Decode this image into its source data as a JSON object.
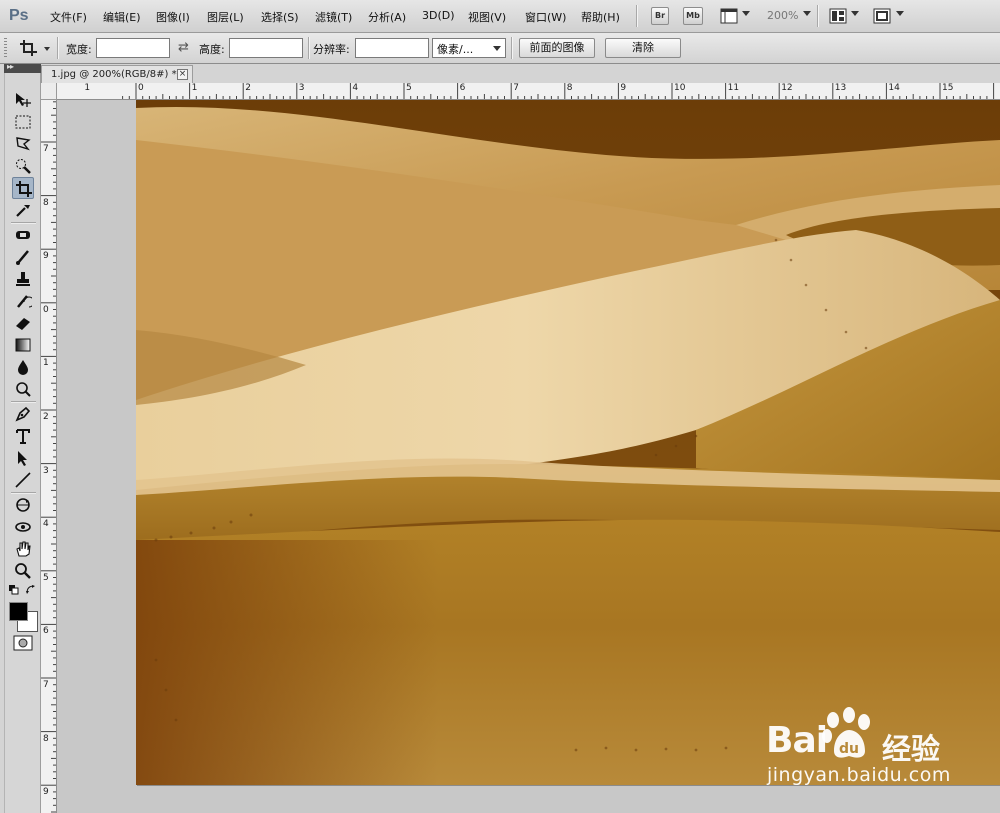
{
  "app": {
    "logo_text": "Ps",
    "menus": [
      "文件(F)",
      "编辑(E)",
      "图像(I)",
      "图层(L)",
      "选择(S)",
      "滤镜(T)",
      "分析(A)",
      "3D(D)",
      "视图(V)",
      "窗口(W)",
      "帮助(H)"
    ],
    "bridge_label": "Br",
    "minibridge_label": "Mb",
    "zoom": "200%"
  },
  "options": {
    "width_label": "宽度:",
    "width_value": "",
    "swap_symbol": "⇄",
    "height_label": "高度:",
    "height_value": "",
    "resolution_label": "分辨率:",
    "resolution_value": "",
    "unit_select": "像素/...",
    "front_image_button": "前面的图像",
    "clear_button": "清除"
  },
  "document": {
    "tab_title": "1.jpg @ 200%(RGB/8#) *",
    "close_symbol": "×"
  },
  "ruler": {
    "h_labels": [
      "1",
      "0",
      "1",
      "2",
      "3",
      "4",
      "5",
      "6",
      "7",
      "8",
      "9",
      "10",
      "11",
      "12",
      "13",
      "14",
      "15"
    ],
    "v_labels": [
      "7",
      "8",
      "9",
      "0",
      "1",
      "2",
      "3",
      "4",
      "5",
      "6",
      "7",
      "8",
      "9"
    ]
  },
  "tools": [
    {
      "name": "move-tool-icon"
    },
    {
      "name": "marquee-tool-icon"
    },
    {
      "name": "lasso-tool-icon"
    },
    {
      "name": "quick-select-tool-icon"
    },
    {
      "name": "crop-tool-icon",
      "active": true
    },
    {
      "name": "eyedropper-tool-icon"
    },
    {
      "name": "spot-healing-tool-icon"
    },
    {
      "name": "brush-tool-icon"
    },
    {
      "name": "clone-stamp-tool-icon"
    },
    {
      "name": "history-brush-tool-icon"
    },
    {
      "name": "eraser-tool-icon"
    },
    {
      "name": "gradient-tool-icon"
    },
    {
      "name": "blur-tool-icon"
    },
    {
      "name": "dodge-tool-icon"
    },
    {
      "name": "pen-tool-icon"
    },
    {
      "name": "type-tool-icon"
    },
    {
      "name": "path-select-tool-icon"
    },
    {
      "name": "line-tool-icon"
    },
    {
      "name": "3d-rotate-tool-icon"
    },
    {
      "name": "3d-orbit-tool-icon"
    },
    {
      "name": "hand-tool-icon"
    },
    {
      "name": "zoom-tool-icon"
    }
  ],
  "colors": {
    "foreground": "#000000",
    "background": "#ffffff",
    "active_tool": "#a6b6c8"
  },
  "watermark": {
    "brand": "Bai",
    "brand_suffix": "经验",
    "url": "jingyan.baidu.com"
  }
}
